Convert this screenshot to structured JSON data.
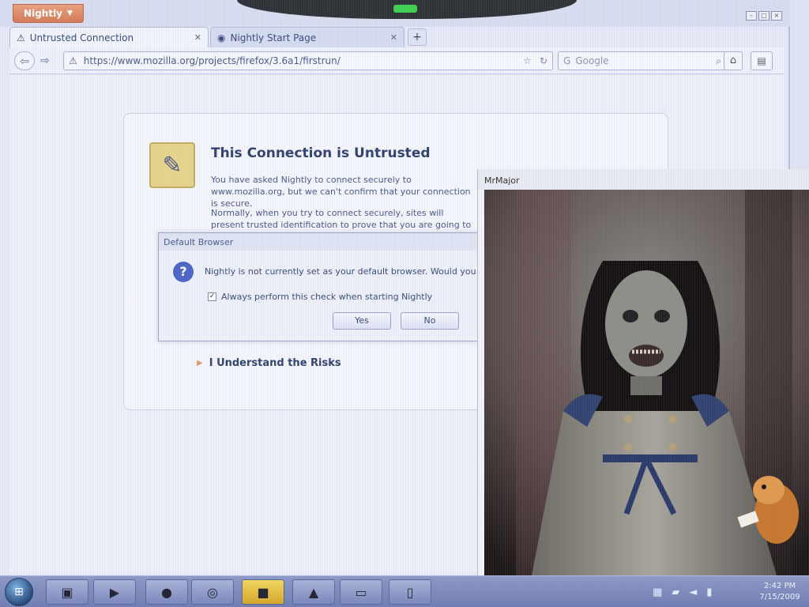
{
  "browser": {
    "app_button_label": "Nightly",
    "tabs": [
      {
        "label": "Untrusted Connection"
      },
      {
        "label": "Nightly Start Page"
      }
    ],
    "new_tab_label": "+",
    "url": "https://www.mozilla.org/projects/firefox/3.6a1/firstrun/",
    "search_engine": "Google",
    "search_placeholder": "Google"
  },
  "error_page": {
    "title": "This Connection is Untrusted",
    "paragraph1": "You have asked Nightly to connect securely to www.mozilla.org, but we can't confirm that your connection is secure.",
    "paragraph2": "Normally, when you try to connect securely, sites will present trusted identification to prove that you are going to the right place. However, this site's identity can't be verified.",
    "risks_label": "I Understand the Risks"
  },
  "dialog": {
    "title": "Default Browser",
    "message": "Nightly is not currently set as your default browser. Would you like to make it your default browser?",
    "checkbox_label": "Always perform this check when starting Nightly",
    "checkbox_checked": true,
    "yes_label": "Yes",
    "no_label": "No"
  },
  "viewer": {
    "title": "MrMajor"
  },
  "taskbar": {
    "clock_time": "2:42 PM",
    "clock_date": "7/15/2009"
  },
  "colors": {
    "accent": "#d57a55",
    "taskbar": "#7a87bb",
    "active_task": "#d8a626"
  }
}
